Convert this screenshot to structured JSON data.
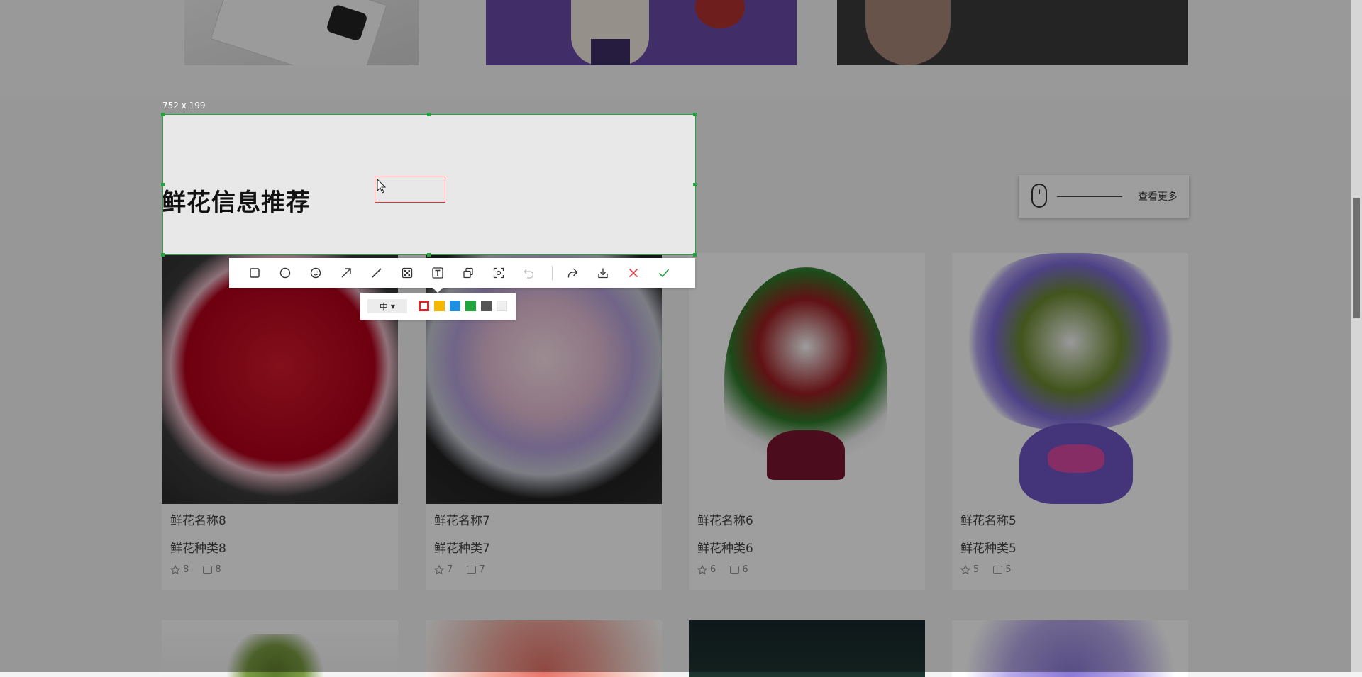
{
  "section": {
    "title": "鲜花信息推荐",
    "more_label": "查看更多"
  },
  "screenshot_tool": {
    "size_label": "752 x 199",
    "toolbar": {
      "tools": [
        "rectangle-icon",
        "circle-icon",
        "emoji-icon",
        "arrow-icon",
        "line-icon",
        "mosaic-icon",
        "text-icon",
        "copy-icon",
        "ocr-scan-icon",
        "undo-icon",
        "share-icon",
        "download-icon",
        "cancel-icon",
        "confirm-icon"
      ]
    },
    "subbar": {
      "size_value": "中",
      "colors": [
        "#d8262b",
        "#f5b800",
        "#1e8fe1",
        "#22a33b",
        "#555555",
        "#f0f0f0"
      ],
      "selected_color": "#d8262b"
    }
  },
  "flowers": [
    {
      "name": "鲜花名称8",
      "type": "鲜花种类8",
      "likes": "8",
      "comments": "8"
    },
    {
      "name": "鲜花名称7",
      "type": "鲜花种类7",
      "likes": "7",
      "comments": "7"
    },
    {
      "name": "鲜花名称6",
      "type": "鲜花种类6",
      "likes": "6",
      "comments": "6"
    },
    {
      "name": "鲜花名称5",
      "type": "鲜花种类5",
      "likes": "5",
      "comments": "5"
    }
  ]
}
